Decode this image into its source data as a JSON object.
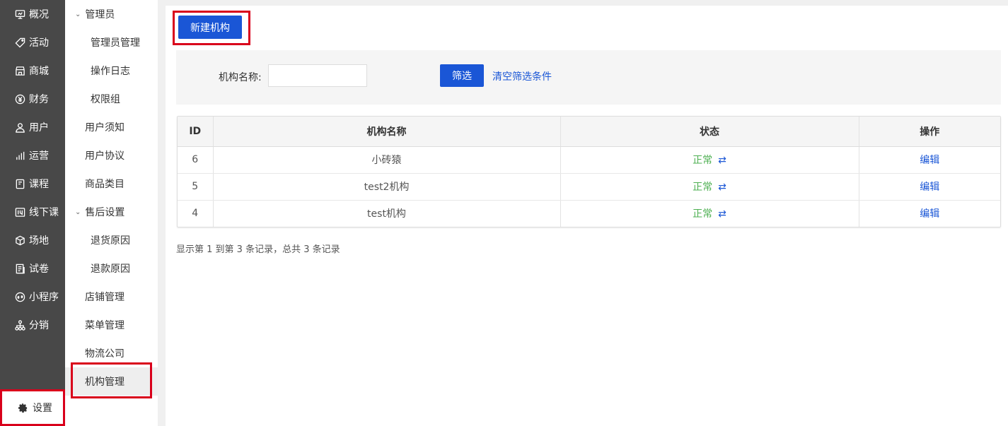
{
  "left_nav": {
    "items": [
      {
        "label": "概况",
        "icon": "monitor-icon"
      },
      {
        "label": "活动",
        "icon": "tag-icon"
      },
      {
        "label": "商城",
        "icon": "store-icon"
      },
      {
        "label": "财务",
        "icon": "yen-icon"
      },
      {
        "label": "用户",
        "icon": "user-icon"
      },
      {
        "label": "运营",
        "icon": "bar-chart-icon"
      },
      {
        "label": "课程",
        "icon": "book-icon"
      },
      {
        "label": "线下课",
        "icon": "calendar-icon"
      },
      {
        "label": "场地",
        "icon": "cube-icon"
      },
      {
        "label": "试卷",
        "icon": "paper-icon"
      },
      {
        "label": "小程序",
        "icon": "miniprogram-icon"
      },
      {
        "label": "分销",
        "icon": "network-icon"
      }
    ],
    "settings_label": "设置"
  },
  "sub_nav": {
    "group_admin": "管理员",
    "admin_manage": "管理员管理",
    "op_log": "操作日志",
    "perm_group": "权限组",
    "user_notice": "用户须知",
    "user_agreement": "用户协议",
    "category": "商品类目",
    "group_aftersale": "售后设置",
    "return_reason": "退货原因",
    "refund_reason": "退款原因",
    "shop_manage": "店铺管理",
    "menu_manage": "菜单管理",
    "logistics": "物流公司",
    "org_manage": "机构管理"
  },
  "toolbar": {
    "new_label": "新建机构"
  },
  "filter": {
    "label": "机构名称:",
    "input_value": "",
    "filter_button": "筛选",
    "clear_link": "清空筛选条件"
  },
  "table": {
    "headers": [
      "ID",
      "机构名称",
      "状态",
      "操作"
    ],
    "rows": [
      {
        "id": "6",
        "name": "小砖猿",
        "status": "正常",
        "toggle": "⇄",
        "action": "编辑"
      },
      {
        "id": "5",
        "name": "test2机构",
        "status": "正常",
        "toggle": "⇄",
        "action": "编辑"
      },
      {
        "id": "4",
        "name": "test机构",
        "status": "正常",
        "toggle": "⇄",
        "action": "编辑"
      }
    ]
  },
  "summary": "显示第 1 到第 3 条记录，总共 3 条记录",
  "colors": {
    "primary": "#1a56d6",
    "highlight": "#d9001b",
    "status_ok": "#4caf50",
    "nav_bg": "#484848"
  }
}
